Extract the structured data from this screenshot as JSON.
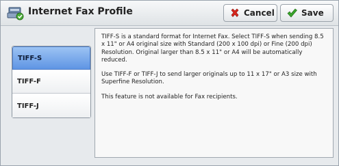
{
  "header": {
    "title": "Internet Fax Profile",
    "title_icon": "fax-profile-icon",
    "cancel_label": "Cancel",
    "save_label": "Save",
    "cancel_icon": "red-x-icon",
    "save_icon": "green-check-icon"
  },
  "profile_list": {
    "items": [
      {
        "label": "TIFF-S",
        "selected": true
      },
      {
        "label": "TIFF-F",
        "selected": false
      },
      {
        "label": "TIFF-J",
        "selected": false
      }
    ]
  },
  "description": {
    "paragraph1": "TIFF-S is a standard format for Internet Fax. Select TIFF-S when sending 8.5 x 11\" or A4 original size with Standard (200 x 100 dpi) or Fine (200 dpi) Resolution.  Original larger than 8.5 x 11\" or A4 will be automatically reduced.",
    "paragraph2": "Use TIFF-F or TIFF-J to send larger originals up to 11 x 17\" or A3 size with Superfine Resolution.",
    "paragraph3": "This feature is not available for Fax recipients."
  },
  "colors": {
    "selected_item": "#6fa3ea",
    "cancel_icon": "#d8261c",
    "save_icon": "#3aa52b"
  }
}
